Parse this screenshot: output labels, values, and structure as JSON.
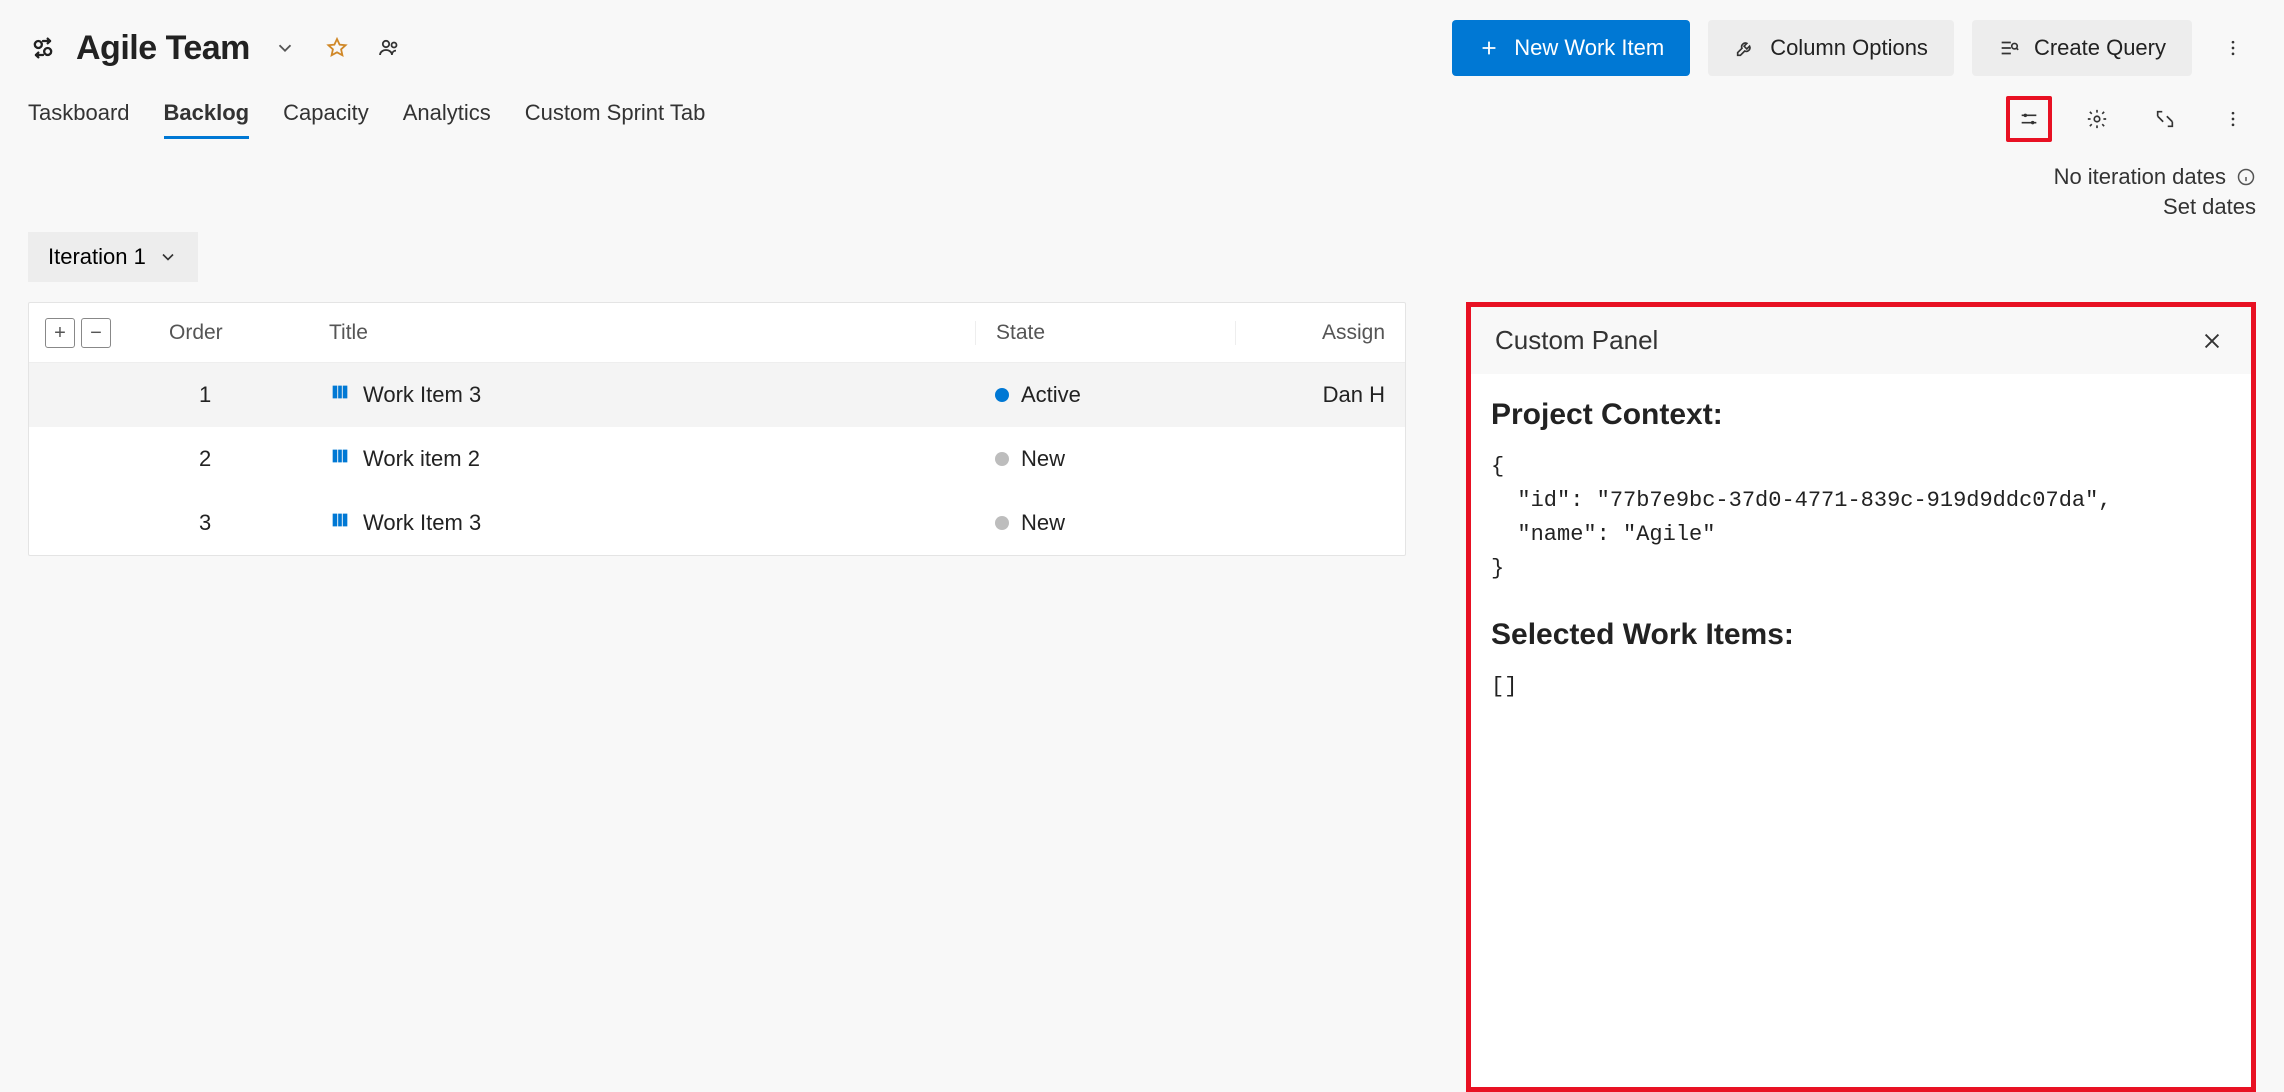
{
  "header": {
    "team_name": "Agile Team",
    "buttons": {
      "new_work_item": "New Work Item",
      "column_options": "Column Options",
      "create_query": "Create Query"
    }
  },
  "tabs": [
    {
      "label": "Taskboard",
      "active": false
    },
    {
      "label": "Backlog",
      "active": true
    },
    {
      "label": "Capacity",
      "active": false
    },
    {
      "label": "Analytics",
      "active": false
    },
    {
      "label": "Custom Sprint Tab",
      "active": false
    }
  ],
  "iteration": {
    "label": "Iteration 1"
  },
  "dates": {
    "no_dates": "No iteration dates",
    "set_dates": "Set dates"
  },
  "grid": {
    "columns": {
      "order": "Order",
      "title": "Title",
      "state": "State",
      "assigned": "Assign"
    },
    "rows": [
      {
        "order": "1",
        "title": "Work Item 3",
        "state": "Active",
        "state_kind": "active",
        "assigned": "Dan H",
        "selected": true
      },
      {
        "order": "2",
        "title": "Work item 2",
        "state": "New",
        "state_kind": "new",
        "assigned": "",
        "selected": false
      },
      {
        "order": "3",
        "title": "Work Item 3",
        "state": "New",
        "state_kind": "new",
        "assigned": "",
        "selected": false
      }
    ]
  },
  "panel": {
    "title": "Custom Panel",
    "section1": "Project Context:",
    "json1": "{\n  \"id\": \"77b7e9bc-37d0-4771-839c-919d9ddc07da\",\n  \"name\": \"Agile\"\n}",
    "section2": "Selected Work Items:",
    "json2": "[]"
  }
}
